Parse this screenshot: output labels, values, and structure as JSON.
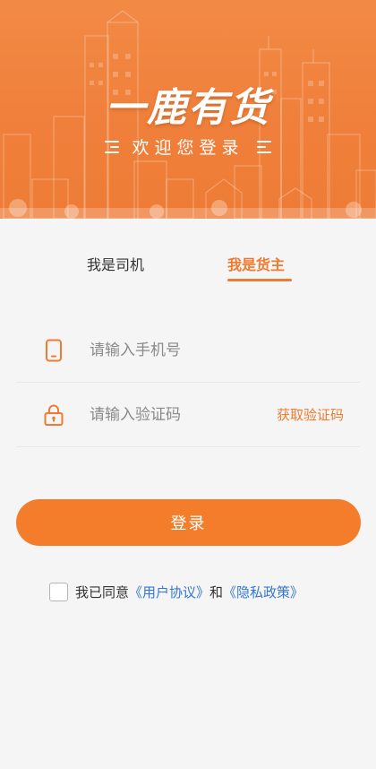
{
  "header": {
    "brand": "一鹿有货",
    "welcome": "欢迎您登录"
  },
  "tabs": [
    {
      "label": "我是司机",
      "active": false
    },
    {
      "label": "我是货主",
      "active": true
    }
  ],
  "form": {
    "phone_placeholder": "请输入手机号",
    "code_placeholder": "请输入验证码",
    "get_code_label": "获取验证码"
  },
  "login_label": "登录",
  "agreement": {
    "checked": false,
    "prefix": "我已同意",
    "user_agreement": "《用户协议》",
    "and": "和",
    "privacy_policy": "《隐私政策》"
  },
  "colors": {
    "accent": "#f07a2f",
    "banner": "#ef7f3a",
    "link": "#3477d4",
    "background": "#f5f5f5"
  },
  "icons": {
    "phone": "phone-icon",
    "lock": "lock-icon"
  }
}
